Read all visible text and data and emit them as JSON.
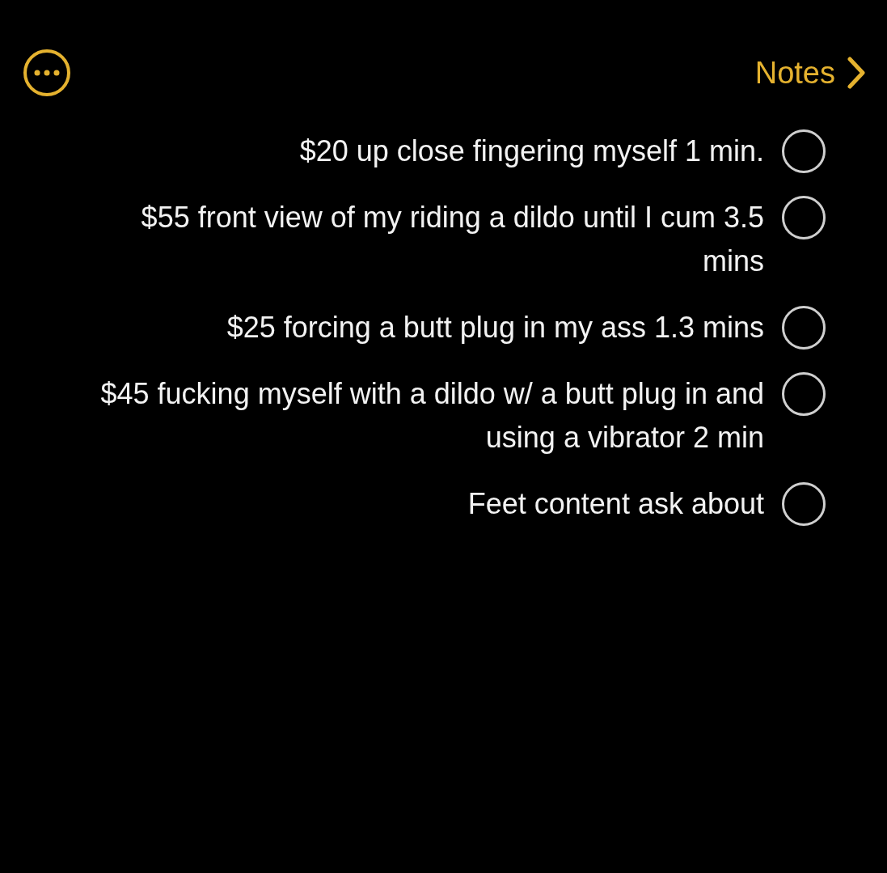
{
  "nav": {
    "back_label": "Notes"
  },
  "checklist": [
    {
      "text": "$20 up close fingering myself 1 min.",
      "checked": false
    },
    {
      "text": "$55 front view of my riding a dildo until I cum 3.5 mins",
      "checked": false
    },
    {
      "text": "$25 forcing a butt plug in my ass 1.3 mins",
      "checked": false
    },
    {
      "text": "$45 fucking myself with a dildo w/ a butt plug in and using a vibrator 2 min",
      "checked": false
    },
    {
      "text": "Feet content ask about",
      "checked": false
    }
  ]
}
